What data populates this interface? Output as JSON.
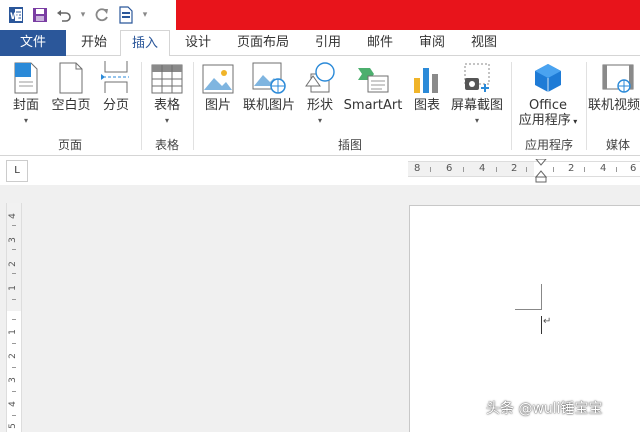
{
  "qat": {
    "app_icon": "word-app-icon",
    "save_icon": "save-icon",
    "undo_icon": "undo-icon",
    "redo_icon": "redo-icon",
    "new_doc_icon": "new-document-icon",
    "customize_icon": "customize-qat-icon"
  },
  "colors": {
    "title_red": "#e8141b",
    "file_blue": "#2b579a",
    "accent": "#2b579a"
  },
  "tabs": {
    "file": "文件",
    "start": "开始",
    "insert": "插入",
    "design": "设计",
    "layout": "页面布局",
    "references": "引用",
    "mailings": "邮件",
    "review": "审阅",
    "view": "视图"
  },
  "ribbon": {
    "cover": "封面",
    "blank_page": "空白页",
    "page_break": "分页",
    "table": "表格",
    "picture": "图片",
    "online_picture": "联机图片",
    "shapes": "形状",
    "smartart": "SmartArt",
    "chart": "图表",
    "screenshot": "屏幕截图",
    "office_line1": "Office",
    "office_line2": "应用程序",
    "online_video": "联机视频"
  },
  "groups": {
    "pages": "页面",
    "tables": "表格",
    "illustrations": "插图",
    "apps": "应用程序",
    "media": "媒体"
  },
  "ruler": {
    "tab_selector": "L",
    "h_numbers": [
      "8",
      "6",
      "4",
      "2",
      "2",
      "4",
      "6"
    ],
    "v_numbers": [
      "4",
      "3",
      "2",
      "1",
      "1",
      "2",
      "3",
      "4",
      "5"
    ]
  },
  "watermark": "头条 @wuli锤宝宝"
}
